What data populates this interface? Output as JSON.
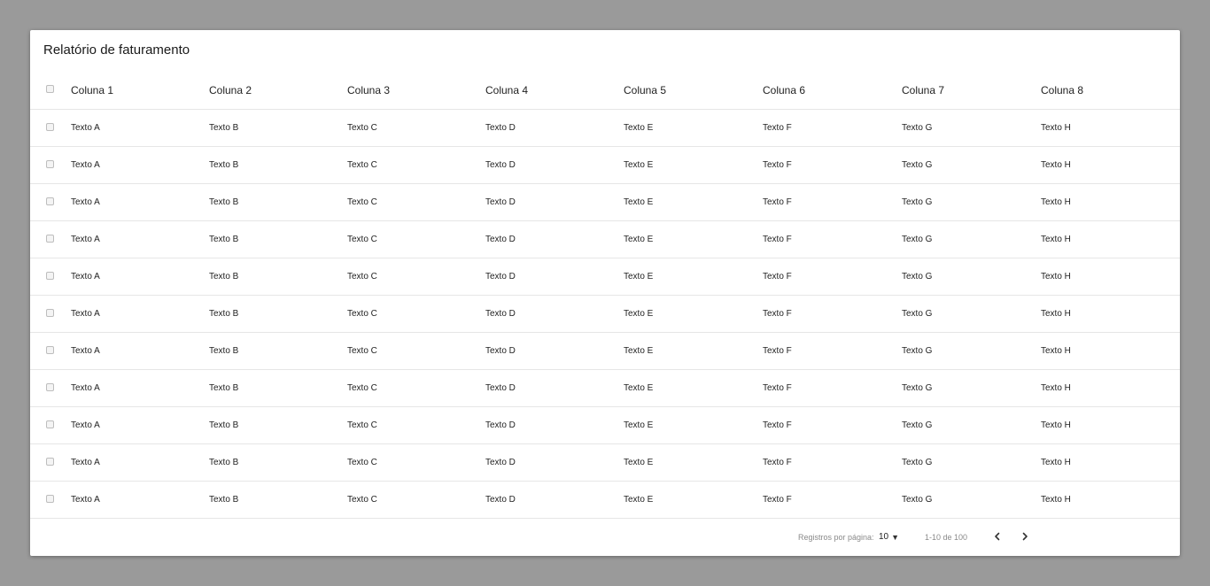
{
  "card": {
    "title": "Relatório de faturamento"
  },
  "table": {
    "columns": [
      "Coluna 1",
      "Coluna 2",
      "Coluna 3",
      "Coluna 4",
      "Coluna 5",
      "Coluna 6",
      "Coluna 7",
      "Coluna 8"
    ],
    "rows": [
      [
        "Texto A",
        "Texto B",
        "Texto C",
        "Texto D",
        "Texto E",
        "Texto F",
        "Texto G",
        "Texto H"
      ],
      [
        "Texto A",
        "Texto B",
        "Texto C",
        "Texto D",
        "Texto E",
        "Texto F",
        "Texto G",
        "Texto H"
      ],
      [
        "Texto A",
        "Texto B",
        "Texto C",
        "Texto D",
        "Texto E",
        "Texto F",
        "Texto G",
        "Texto H"
      ],
      [
        "Texto A",
        "Texto B",
        "Texto C",
        "Texto D",
        "Texto E",
        "Texto F",
        "Texto G",
        "Texto H"
      ],
      [
        "Texto A",
        "Texto B",
        "Texto C",
        "Texto D",
        "Texto E",
        "Texto F",
        "Texto G",
        "Texto H"
      ],
      [
        "Texto A",
        "Texto B",
        "Texto C",
        "Texto D",
        "Texto E",
        "Texto F",
        "Texto G",
        "Texto H"
      ],
      [
        "Texto A",
        "Texto B",
        "Texto C",
        "Texto D",
        "Texto E",
        "Texto F",
        "Texto G",
        "Texto H"
      ],
      [
        "Texto A",
        "Texto B",
        "Texto C",
        "Texto D",
        "Texto E",
        "Texto F",
        "Texto G",
        "Texto H"
      ],
      [
        "Texto A",
        "Texto B",
        "Texto C",
        "Texto D",
        "Texto E",
        "Texto F",
        "Texto G",
        "Texto H"
      ],
      [
        "Texto A",
        "Texto B",
        "Texto C",
        "Texto D",
        "Texto E",
        "Texto F",
        "Texto G",
        "Texto H"
      ],
      [
        "Texto A",
        "Texto B",
        "Texto C",
        "Texto D",
        "Texto E",
        "Texto F",
        "Texto G",
        "Texto H"
      ]
    ]
  },
  "pagination": {
    "rows_per_page_label": "Registros por página:",
    "rows_per_page_value": "10",
    "range_label": "1-10 de 100",
    "prev_icon": "chevron-left-icon",
    "next_icon": "chevron-right-icon"
  },
  "colors": {
    "backdrop": "#9a9a9a",
    "card": "#ffffff",
    "divider": "#e6e6e6",
    "muted_text": "#8a8a8a"
  }
}
